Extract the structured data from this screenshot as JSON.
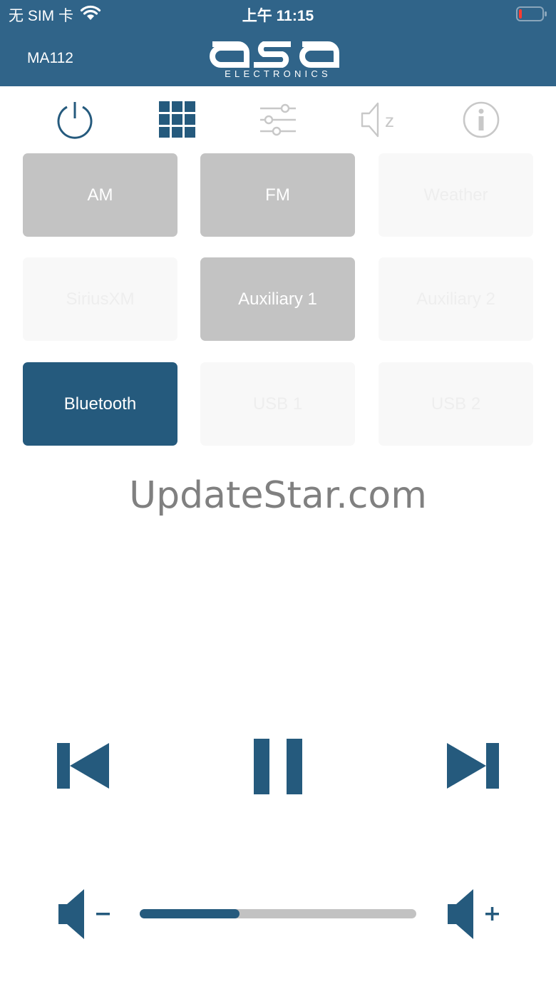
{
  "status_bar": {
    "carrier": "无 SIM 卡",
    "time": "上午 11:15"
  },
  "header": {
    "device_name": "MA112",
    "logo_text": "asa",
    "logo_subtext": "ELECTRONICS"
  },
  "tabs": [
    {
      "icon": "power-icon"
    },
    {
      "icon": "grid-icon"
    },
    {
      "icon": "sliders-icon"
    },
    {
      "icon": "mute-speaker-icon"
    },
    {
      "icon": "info-icon"
    }
  ],
  "sources": [
    {
      "label": "AM",
      "state": "available"
    },
    {
      "label": "FM",
      "state": "available"
    },
    {
      "label": "Weather",
      "state": "unavailable"
    },
    {
      "label": "SiriusXM",
      "state": "unavailable"
    },
    {
      "label": "Auxiliary 1",
      "state": "available"
    },
    {
      "label": "Auxiliary 2",
      "state": "unavailable"
    },
    {
      "label": "Bluetooth",
      "state": "active"
    },
    {
      "label": "USB 1",
      "state": "unavailable"
    },
    {
      "label": "USB 2",
      "state": "unavailable"
    }
  ],
  "watermark": "UpdateStar.com",
  "transport": {
    "previous_icon": "skip-previous-icon",
    "pause_icon": "pause-icon",
    "next_icon": "skip-next-icon"
  },
  "volume": {
    "level_fraction": 0.36,
    "down_icon": "volume-down-icon",
    "up_icon": "volume-up-icon"
  },
  "colors": {
    "header_bg": "#306489",
    "accent": "#255a7d",
    "source_available": "#c3c3c3",
    "source_unavailable": "#f8f8f8",
    "icon_inactive": "#c8c8c8"
  }
}
